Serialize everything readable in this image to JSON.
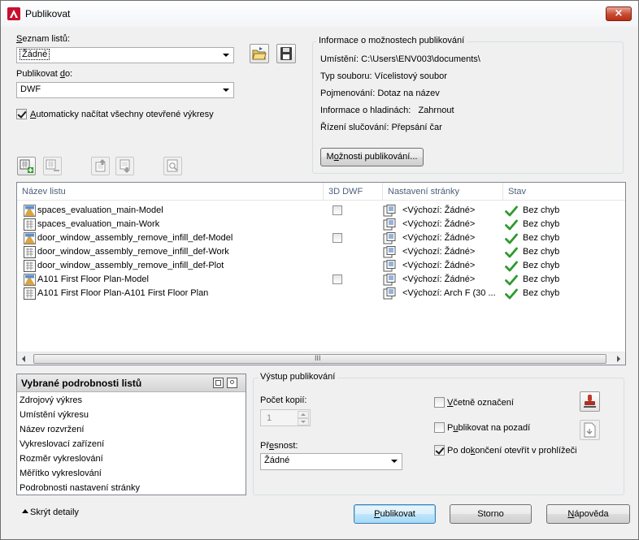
{
  "window": {
    "title": "Publikovat",
    "close_glyph": "×"
  },
  "colors": {
    "status_ok": "#2e9a2e",
    "close_red": "#c74a32",
    "accent": "#3c7fb1"
  },
  "sheet_list": {
    "label_pre": "",
    "label_key": "S",
    "label_post": "eznam listů:",
    "value": "Žádné"
  },
  "publish_to": {
    "label_pre": "Publikovat ",
    "label_key": "d",
    "label_post": "o:",
    "value": "DWF"
  },
  "auto_load": {
    "checked": true,
    "label_pre": "",
    "label_key": "A",
    "label_post": "utomaticky načítat všechny otevřené výkresy"
  },
  "info_group": {
    "title": "Informace o možnostech publikování",
    "rows": [
      {
        "label": "Umístění:",
        "value": "C:\\Users\\ENV003\\documents\\"
      },
      {
        "label": "Typ souboru:",
        "value": "Vícelistový soubor"
      },
      {
        "label": "Pojmenování:",
        "value": "Dotaz na název"
      },
      {
        "label": "Informace o hladinách:",
        "value": "Zahrnout"
      },
      {
        "label": "Řízení slučování:",
        "value": "Přepsání čar"
      }
    ],
    "options_button": {
      "pre": "M",
      "key": "o",
      "post": "žnosti publikování..."
    }
  },
  "list": {
    "columns": [
      "Název listu",
      "3D DWF",
      "Nastavení stránky",
      "Stav"
    ],
    "rows": [
      {
        "name": "spaces_evaluation_main-Model",
        "type": "model",
        "dwf3d": true,
        "page_setup": "<Výchozí: Žádné>",
        "status": "Bez chyb"
      },
      {
        "name": "spaces_evaluation_main-Work",
        "type": "layout",
        "dwf3d": false,
        "page_setup": "<Výchozí: Žádné>",
        "status": "Bez chyb"
      },
      {
        "name": "door_window_assembly_remove_infill_def-Model",
        "type": "model",
        "dwf3d": true,
        "page_setup": "<Výchozí: Žádné>",
        "status": "Bez chyb"
      },
      {
        "name": "door_window_assembly_remove_infill_def-Work",
        "type": "layout",
        "dwf3d": false,
        "page_setup": "<Výchozí: Žádné>",
        "status": "Bez chyb"
      },
      {
        "name": "door_window_assembly_remove_infill_def-Plot",
        "type": "layout",
        "dwf3d": false,
        "page_setup": "<Výchozí: Žádné>",
        "status": "Bez chyb"
      },
      {
        "name": "A101 First Floor Plan-Model",
        "type": "model",
        "dwf3d": true,
        "page_setup": "<Výchozí: Žádné>",
        "status": "Bez chyb"
      },
      {
        "name": "A101 First Floor Plan-A101 First Floor Plan",
        "type": "layout",
        "dwf3d": false,
        "page_setup": "<Výchozí: Arch F (30 ...",
        "status": "Bez chyb"
      }
    ],
    "scroll_grip": "III"
  },
  "details": {
    "title": "Vybrané podrobnosti listů",
    "items": [
      "Zdrojový výkres",
      "Umístění výkresu",
      "Název rozvržení",
      "Vykreslovací zařízení",
      "Rozměr vykreslování",
      "Měřítko vykreslování",
      "Podrobnosti nastavení stránky"
    ]
  },
  "output": {
    "title": "Výstup publikování",
    "copies_label": "Počet kopií:",
    "copies_value": "1",
    "precision": {
      "pre": "Př",
      "key": "e",
      "post": "snost:",
      "value": "Žádné"
    },
    "include_stamp": {
      "checked": false,
      "pre": "",
      "key": "V",
      "post": "četně označení"
    },
    "background": {
      "checked": false,
      "pre": "P",
      "key": "u",
      "post": "blikovat na pozadí"
    },
    "open_viewer": {
      "checked": true,
      "pre": "Po do",
      "key": "k",
      "post": "ončení otevřít v prohlížeči"
    }
  },
  "footer": {
    "hide_details": "Skrýt detaily",
    "publish": {
      "pre": "",
      "key": "P",
      "post": "ublikovat"
    },
    "cancel": "Storno",
    "help": {
      "pre": "",
      "key": "N",
      "post": "ápověda"
    }
  }
}
